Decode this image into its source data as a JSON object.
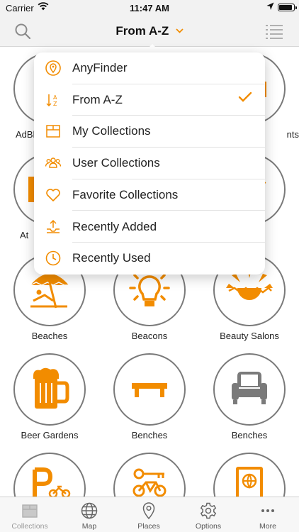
{
  "status_bar": {
    "carrier": "Carrier",
    "time": "11:47 AM"
  },
  "nav": {
    "title": "From A-Z",
    "chevron": "⌄"
  },
  "menu": {
    "items": [
      {
        "label": "AnyFinder",
        "icon": "location-pin-icon",
        "checked": false
      },
      {
        "label": "From A-Z",
        "icon": "sort-az-icon",
        "checked": true
      },
      {
        "label": "My Collections",
        "icon": "box-icon",
        "checked": false
      },
      {
        "label": "User Collections",
        "icon": "users-icon",
        "checked": false
      },
      {
        "label": "Favorite Collections",
        "icon": "heart-icon",
        "checked": false
      },
      {
        "label": "Recently Added",
        "icon": "recently-added-icon",
        "checked": false
      },
      {
        "label": "Recently Used",
        "icon": "clock-icon",
        "checked": false
      }
    ],
    "check_glyph": "✓"
  },
  "grid": {
    "cells": [
      {
        "label": "AdBl",
        "icon": "adblock-icon"
      },
      {
        "label": "",
        "icon": "hidden"
      },
      {
        "label": "nts",
        "icon": "partial-icon"
      },
      {
        "label": "At",
        "icon": "partial-icon"
      },
      {
        "label": "",
        "icon": "hidden"
      },
      {
        "label": "",
        "icon": "partial-icon"
      },
      {
        "label": "Beaches",
        "icon": "beach-umbrella-icon"
      },
      {
        "label": "Beacons",
        "icon": "lightbulb-icon"
      },
      {
        "label": "Beauty Salons",
        "icon": "sun-icon"
      },
      {
        "label": "Beer Gardens",
        "icon": "beer-mug-icon"
      },
      {
        "label": "Benches",
        "icon": "bench-icon"
      },
      {
        "label": "Benches",
        "icon": "armchair-icon"
      },
      {
        "label": "",
        "icon": "bike-parking-icon"
      },
      {
        "label": "",
        "icon": "bike-key-icon"
      },
      {
        "label": "",
        "icon": "passport-icon"
      }
    ]
  },
  "tabs": [
    {
      "label": "Collections",
      "icon": "box-icon",
      "active": true
    },
    {
      "label": "Map",
      "icon": "globe-icon",
      "active": false
    },
    {
      "label": "Places",
      "icon": "map-pin-icon",
      "active": false
    },
    {
      "label": "Options",
      "icon": "gear-icon",
      "active": false
    },
    {
      "label": "More",
      "icon": "more-dots-icon",
      "active": false
    }
  ],
  "colors": {
    "accent": "#f28c00",
    "circle_border": "#7a7a7a",
    "icon_gray": "#8a8a8a"
  }
}
